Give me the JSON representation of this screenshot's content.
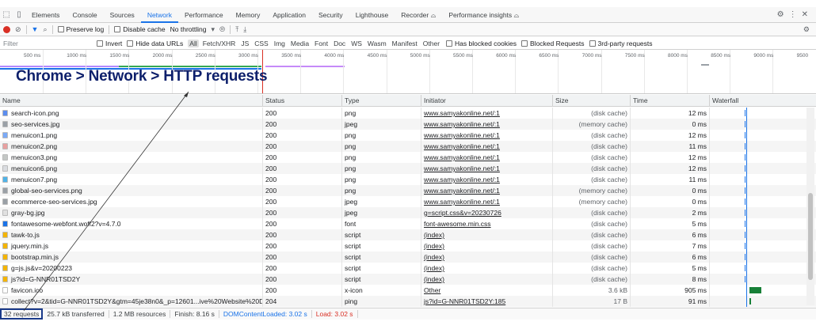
{
  "tabs": [
    "Elements",
    "Console",
    "Sources",
    "Network",
    "Performance",
    "Memory",
    "Application",
    "Security",
    "Lighthouse",
    "Recorder ⌓",
    "Performance insights ⌓"
  ],
  "active_tab": "Network",
  "toolbar": {
    "preserve_log": "Preserve log",
    "disable_cache": "Disable cache",
    "throttling": "No throttling"
  },
  "filter": {
    "placeholder": "Filter",
    "invert": "Invert",
    "hide_data_urls": "Hide data URLs",
    "types": [
      "All",
      "Fetch/XHR",
      "JS",
      "CSS",
      "Img",
      "Media",
      "Font",
      "Doc",
      "WS",
      "Wasm",
      "Manifest",
      "Other"
    ],
    "blocked_cookies": "Has blocked cookies",
    "blocked_requests": "Blocked Requests",
    "third_party": "3rd-party requests"
  },
  "overview_ticks": [
    "500 ms",
    "1000 ms",
    "1500 ms",
    "2000 ms",
    "2500 ms",
    "3000 ms",
    "3500 ms",
    "4000 ms",
    "4500 ms",
    "5000 ms",
    "5500 ms",
    "6000 ms",
    "6500 ms",
    "7000 ms",
    "7500 ms",
    "8000 ms",
    "8500 ms",
    "9000 ms",
    "9500"
  ],
  "annotation": "Chrome > Network > HTTP requests",
  "columns": {
    "name": "Name",
    "status": "Status",
    "type": "Type",
    "initiator": "Initiator",
    "size": "Size",
    "time": "Time",
    "waterfall": "Waterfall"
  },
  "rows": [
    {
      "name": "search-icon.png",
      "status": "200",
      "type": "png",
      "initiator": "www.samyakonline.net/:1",
      "size": "(disk cache)",
      "time": "12 ms",
      "icon": "#5b8def"
    },
    {
      "name": "seo-services.jpg",
      "status": "200",
      "type": "jpeg",
      "initiator": "www.samyakonline.net/:1",
      "size": "(memory cache)",
      "time": "0 ms",
      "icon": "#9aa0a6"
    },
    {
      "name": "menuicon1.png",
      "status": "200",
      "type": "png",
      "initiator": "www.samyakonline.net/:1",
      "size": "(disk cache)",
      "time": "12 ms",
      "icon": "#7baaf7"
    },
    {
      "name": "menuicon2.png",
      "status": "200",
      "type": "png",
      "initiator": "www.samyakonline.net/:1",
      "size": "(disk cache)",
      "time": "11 ms",
      "icon": "#e8a0a0"
    },
    {
      "name": "menuicon3.png",
      "status": "200",
      "type": "png",
      "initiator": "www.samyakonline.net/:1",
      "size": "(disk cache)",
      "time": "12 ms",
      "icon": "#c4c7c5"
    },
    {
      "name": "menuicon6.png",
      "status": "200",
      "type": "png",
      "initiator": "www.samyakonline.net/:1",
      "size": "(disk cache)",
      "time": "12 ms",
      "icon": "#dadce0"
    },
    {
      "name": "menuicon7.png",
      "status": "200",
      "type": "png",
      "initiator": "www.samyakonline.net/:1",
      "size": "(disk cache)",
      "time": "11 ms",
      "icon": "#4fb3e8"
    },
    {
      "name": "global-seo-services.png",
      "status": "200",
      "type": "png",
      "initiator": "www.samyakonline.net/:1",
      "size": "(memory cache)",
      "time": "0 ms",
      "icon": "#9aa0a6"
    },
    {
      "name": "ecommerce-seo-services.jpg",
      "status": "200",
      "type": "jpeg",
      "initiator": "www.samyakonline.net/:1",
      "size": "(memory cache)",
      "time": "0 ms",
      "icon": "#9aa0a6"
    },
    {
      "name": "gray-bg.jpg",
      "status": "200",
      "type": "jpeg",
      "initiator": "g=script.css&v=20230726",
      "size": "(disk cache)",
      "time": "2 ms",
      "icon": "#e0e0e0"
    },
    {
      "name": "fontawesome-webfont.woff2?v=4.7.0",
      "status": "200",
      "type": "font",
      "initiator": "font-awesome.min.css",
      "size": "(disk cache)",
      "time": "5 ms",
      "icon": "#1a73e8"
    },
    {
      "name": "tawk-to.js",
      "status": "200",
      "type": "script",
      "initiator": "(index)",
      "size": "(disk cache)",
      "time": "6 ms",
      "icon": "#f4b400"
    },
    {
      "name": "jquery.min.js",
      "status": "200",
      "type": "script",
      "initiator": "(index)",
      "size": "(disk cache)",
      "time": "7 ms",
      "icon": "#f4b400"
    },
    {
      "name": "bootstrap.min.js",
      "status": "200",
      "type": "script",
      "initiator": "(index)",
      "size": "(disk cache)",
      "time": "6 ms",
      "icon": "#f4b400"
    },
    {
      "name": "g=js.js&v=20200223",
      "status": "200",
      "type": "script",
      "initiator": "(index)",
      "size": "(disk cache)",
      "time": "5 ms",
      "icon": "#f4b400"
    },
    {
      "name": "js?id=G-NNR01TSD2Y",
      "status": "200",
      "type": "script",
      "initiator": "(index)",
      "size": "(disk cache)",
      "time": "8 ms",
      "icon": "#f4b400"
    },
    {
      "name": "favicon.ico",
      "status": "200",
      "type": "x-icon",
      "initiator": "Other",
      "size": "3.6 kB",
      "time": "905 ms",
      "icon": "#ffffff"
    },
    {
      "name": "collect?v=2&tid=G-NNR01TSD2Y&gtm=45je38n0&_p=12601...ive%20Website%20De...",
      "status": "204",
      "type": "ping",
      "initiator": "js?id=G-NNR01TSD2Y:185",
      "size": "17 B",
      "time": "91 ms",
      "icon": "#ffffff"
    }
  ],
  "status_bar": {
    "requests": "32 requests",
    "transferred": "25.7 kB transferred",
    "resources": "1.2 MB resources",
    "finish": "Finish: 8.16 s",
    "dcl": "DOMContentLoaded: 3.02 s",
    "load": "Load: 3.02 s"
  },
  "colors": {
    "accent": "#1a73e8",
    "record": "#d93025",
    "annotation": "#0d1f6b"
  }
}
